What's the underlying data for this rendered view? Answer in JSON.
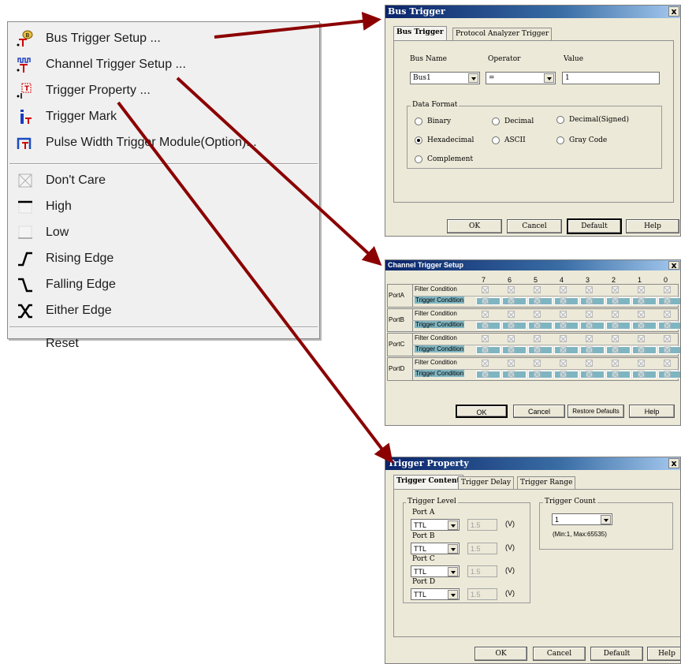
{
  "menu": {
    "items": [
      {
        "label": "Bus Trigger Setup ...",
        "icon": "bus-trigger-icon"
      },
      {
        "label": "Channel Trigger Setup ...",
        "icon": "channel-trigger-icon"
      },
      {
        "label": "Trigger Property ...",
        "icon": "trigger-property-icon"
      },
      {
        "label": "Trigger Mark",
        "icon": "trigger-mark-icon"
      },
      {
        "label": "Pulse Width Trigger Module(Option)...",
        "icon": "pulse-width-icon"
      },
      {
        "label": "Don't Care",
        "icon": "dont-care-icon"
      },
      {
        "label": "High",
        "icon": "high-icon"
      },
      {
        "label": "Low",
        "icon": "low-icon"
      },
      {
        "label": "Rising Edge",
        "icon": "rising-edge-icon"
      },
      {
        "label": "Falling Edge",
        "icon": "falling-edge-icon"
      },
      {
        "label": "Either Edge",
        "icon": "either-edge-icon"
      },
      {
        "label": "Reset",
        "icon": ""
      }
    ]
  },
  "bus_trigger": {
    "title": "Bus Trigger",
    "close": "x",
    "tabs": [
      "Bus Trigger",
      "Protocol Analyzer Trigger"
    ],
    "bus_name_label": "Bus Name",
    "operator_label": "Operator",
    "value_label": "Value",
    "bus_name_value": "Bus1",
    "operator_value": "=",
    "value_value": "1",
    "data_format_label": "Data Format",
    "formats": [
      "Binary",
      "Decimal",
      "Decimal(Signed)",
      "Hexadecimal",
      "ASCII",
      "Gray Code",
      "Complement"
    ],
    "selected_format": "Hexadecimal",
    "buttons": {
      "ok": "OK",
      "cancel": "Cancel",
      "default": "Default",
      "help": "Help"
    }
  },
  "channel_trigger": {
    "title": "Channel Trigger Setup",
    "close": "x",
    "columns": [
      "7",
      "6",
      "5",
      "4",
      "3",
      "2",
      "1",
      "0"
    ],
    "ports": [
      "PortA",
      "PortB",
      "PortC",
      "PortD"
    ],
    "filter_label": "Filter Condition",
    "trigger_label": "Trigger Condition",
    "buttons": {
      "ok": "OK",
      "cancel": "Cancel",
      "restore": "Restore Defaults",
      "help": "Help"
    }
  },
  "trigger_property": {
    "title": "Trigger Property",
    "close": "x",
    "tabs": [
      "Trigger Content",
      "Trigger Delay",
      "Trigger Range"
    ],
    "level_group": "Trigger Level",
    "ports": [
      {
        "label": "Port A",
        "type": "TTL",
        "value": "1.5",
        "unit": "(V)"
      },
      {
        "label": "Port B",
        "type": "TTL",
        "value": "1.5",
        "unit": "(V)"
      },
      {
        "label": "Port C",
        "type": "TTL",
        "value": "1.5",
        "unit": "(V)"
      },
      {
        "label": "Port D",
        "type": "TTL",
        "value": "1.5",
        "unit": "(V)"
      }
    ],
    "count_group": "Trigger Count",
    "count_value": "1",
    "count_range": "(Min:1, Max:65535)",
    "buttons": {
      "ok": "OK",
      "cancel": "Cancel",
      "default": "Default",
      "help": "Help"
    }
  },
  "colors": {
    "arrow": "#8b0000",
    "title_start": "#0a246a",
    "title_end": "#a6caf0",
    "trigger_cell": "#7fb5c1"
  }
}
